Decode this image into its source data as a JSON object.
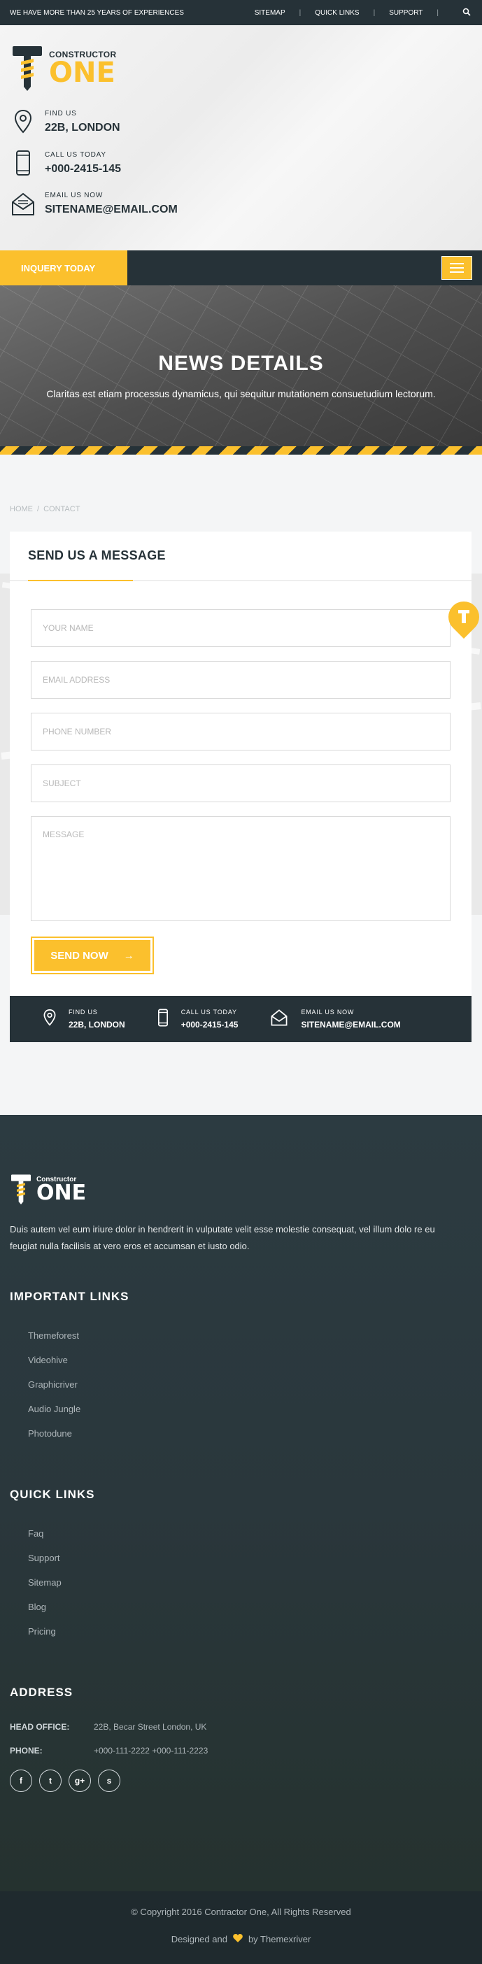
{
  "topbar": {
    "tagline": "WE HAVE MORE THAN 25 YEARS OF EXPERIENCES",
    "links": [
      "SITEMAP",
      "QUICK LINKS",
      "SUPPORT"
    ]
  },
  "brand": {
    "line1": "CONSTRUCTOR",
    "line2": "ONE",
    "accent": "#fbc02d",
    "dark": "#263238"
  },
  "info": [
    {
      "icon": "map-pin-icon",
      "label": "FIND US",
      "value": "22B, LONDON"
    },
    {
      "icon": "phone-icon",
      "label": "CALL US TODAY",
      "value": "+000-2415-145"
    },
    {
      "icon": "envelope-icon",
      "label": "EMAIL US NOW",
      "value": "SITENAME@EMAIL.COM"
    }
  ],
  "nav": {
    "cta": "INQUERY TODAY"
  },
  "banner": {
    "title": "NEWS DETAILS",
    "subtitle": "Claritas est etiam processus dynamicus, qui sequitur mutationem consuetudium lectorum."
  },
  "breadcrumb": {
    "home": "HOME",
    "sep": "/",
    "current": "CONTACT"
  },
  "form": {
    "title": "SEND US A MESSAGE",
    "name": "YOUR NAME",
    "email": "EMAIL ADDRESS",
    "phone": "PHONE NUMBER",
    "subject": "SUBJECT",
    "message": "MESSAGE",
    "send": "SEND NOW",
    "arrow": "→"
  },
  "contactbar": [
    {
      "label": "FIND US",
      "value": "22B, LONDON"
    },
    {
      "label": "CALL US TODAY",
      "value": "+000-2415-145"
    },
    {
      "label": "EMAIL US NOW",
      "value": "SITENAME@EMAIL.COM"
    }
  ],
  "footer": {
    "logo1": "Constructor",
    "logo2": "ONE",
    "desc": "Duis autem vel eum iriure dolor in hendrerit in vulputate velit esse molestie consequat, vel illum dolo re eu feugiat nulla facilisis at vero eros et accumsan et iusto odio.",
    "important_title": "IMPORTANT LINKS",
    "important": [
      "Themeforest",
      "Videohive",
      "Graphicriver",
      "Audio Jungle",
      "Photodune"
    ],
    "quick_title": "QUICK LINKS",
    "quick": [
      "Faq",
      "Support",
      "Sitemap",
      "Blog",
      "Pricing"
    ],
    "address_title": "ADDRESS",
    "head_k": "HEAD OFFICE:",
    "head_v": "22B, Becar Street London, UK",
    "phone_k": "PHONE:",
    "phone_v": "+000-111-2222 +000-111-2223",
    "social": [
      "f",
      "t",
      "g+",
      "s"
    ]
  },
  "copyright": {
    "text": "© Copyright 2016 Contractor One, All Rights Reserved",
    "designed": "Designed and",
    "by": "by Themexriver"
  }
}
